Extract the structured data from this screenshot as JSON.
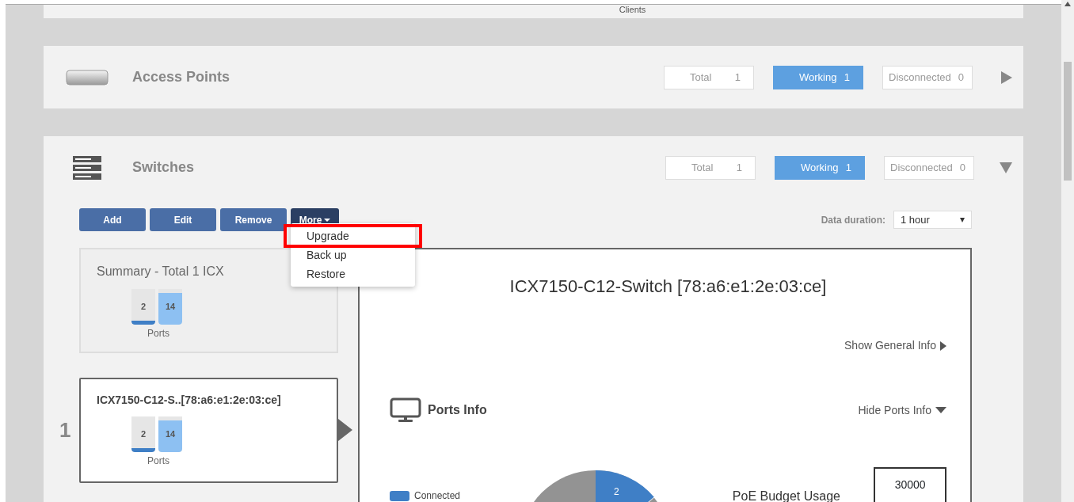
{
  "clients_panel": {
    "label": "Clients"
  },
  "sections": [
    {
      "title": "Access Points",
      "kind": "ap",
      "expanded": false,
      "stats": [
        {
          "label": "Total",
          "value": "1",
          "kind": "plain"
        },
        {
          "label": "Working",
          "value": "1",
          "kind": "active"
        },
        {
          "label": "Disconnected",
          "value": "0",
          "kind": "plain"
        }
      ]
    },
    {
      "title": "Switches",
      "kind": "switch",
      "expanded": true,
      "stats": [
        {
          "label": "Total",
          "value": "1",
          "kind": "plain"
        },
        {
          "label": "Working",
          "value": "1",
          "kind": "active"
        },
        {
          "label": "Disconnected",
          "value": "0",
          "kind": "plain"
        }
      ]
    }
  ],
  "toolbar": {
    "buttons": [
      {
        "label": "Add",
        "kind": "plain"
      },
      {
        "label": "Edit",
        "kind": "plain"
      },
      {
        "label": "Remove",
        "kind": "plain"
      },
      {
        "label": "More",
        "kind": "dropdown"
      }
    ],
    "menu": [
      {
        "label": "Upgrade",
        "highlighted": true
      },
      {
        "label": "Back up",
        "highlighted": false
      },
      {
        "label": "Restore",
        "highlighted": false
      }
    ],
    "duration_label": "Data duration:",
    "duration_value": "1 hour"
  },
  "summary": {
    "title": "Summary - Total 1 ICX",
    "bars": [
      {
        "value": "2",
        "level": 0.12,
        "kind": "connected"
      },
      {
        "value": "14",
        "level": 0.88,
        "kind": "available"
      }
    ],
    "caption": "Ports"
  },
  "devices": [
    {
      "index": "1",
      "name": "ICX7150-C12-S..[78:a6:e1:2e:03:ce]",
      "selected": true,
      "bars": [
        {
          "value": "2",
          "level": 0.12,
          "kind": "connected"
        },
        {
          "value": "14",
          "level": 0.88,
          "kind": "available"
        }
      ],
      "caption": "Ports"
    }
  ],
  "detail": {
    "title": "ICX7150-C12-Switch [78:a6:e1:2e:03:ce]",
    "general_link": "Show General Info",
    "ports_title": "Ports Info",
    "ports_link": "Hide Ports Info",
    "legend": [
      {
        "label": "Connected",
        "color": "#3f7fc6"
      }
    ],
    "pie_label": "2",
    "poe_label": "PoE Budget Usage",
    "poe_value": "30000"
  }
}
